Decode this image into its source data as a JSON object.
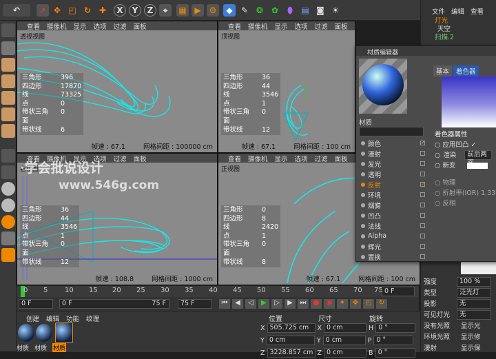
{
  "toolbar": {
    "icons": [
      "undo-icon",
      "select-icon",
      "move-icon",
      "scale-icon",
      "rotate-icon",
      "cursor-add-icon",
      "x-axis-icon",
      "y-axis-icon",
      "z-axis-icon",
      "world-icon",
      "render-view-icon",
      "render-picture-icon",
      "render-settings-icon",
      "cube-icon",
      "pen-icon",
      "sds-icon",
      "array-icon",
      "deformer-icon",
      "scene-icon",
      "camera-icon",
      "light-icon"
    ],
    "axis_x": "X",
    "axis_y": "Y",
    "axis_z": "Z"
  },
  "viewports": {
    "menu": [
      "查看",
      "摄像机",
      "显示",
      "选项",
      "过滤",
      "面板"
    ],
    "persp": {
      "name": "透视视图",
      "stats": [
        [
          "三角形",
          "396"
        ],
        [
          "四边形",
          "17870"
        ],
        [
          "线",
          "73325"
        ],
        [
          "点",
          "0"
        ],
        [
          "带状三角面",
          "0"
        ],
        [
          "带状线",
          "6"
        ]
      ],
      "fps": "帧速 : 67.1",
      "grid": "网格间距 : 100000 cm"
    },
    "top": {
      "name": "顶视图",
      "stats": [
        [
          "三角形",
          "36"
        ],
        [
          "四边形",
          "44"
        ],
        [
          "线",
          "3546"
        ],
        [
          "点",
          "1"
        ],
        [
          "带状三角面",
          "0"
        ],
        [
          "带状线",
          "12"
        ]
      ],
      "fps": "帧速 : 67.1",
      "grid": "网格间距 : 100 cm"
    },
    "right": {
      "name": "右视图",
      "stats": [
        [
          "三角形",
          "36"
        ],
        [
          "四边形",
          "44"
        ],
        [
          "线",
          "3546"
        ],
        [
          "点",
          "1"
        ],
        [
          "带状三角面",
          "0"
        ],
        [
          "带状线",
          "12"
        ]
      ],
      "fps": "帧速 : 108.8",
      "grid": "网格间距 : 1000 cm"
    },
    "front": {
      "name": "正视图",
      "stats": [
        [
          "三角形",
          "0"
        ],
        [
          "四边形",
          "8"
        ],
        [
          "线",
          "2420"
        ],
        [
          "点",
          "1"
        ],
        [
          "带状三角面",
          "0"
        ],
        [
          "带状线",
          "8"
        ]
      ],
      "fps": "帧速 : 67.1",
      "grid": "网格间距 : 100 cm"
    }
  },
  "watermark": {
    "text": "·学会批说设计",
    "url": "www.546g.com"
  },
  "timeline": {
    "ticks": [
      "0",
      "5",
      "10",
      "15",
      "20",
      "25",
      "30",
      "35",
      "40",
      "45",
      "50",
      "55",
      "60",
      "65",
      "70",
      "75"
    ],
    "current": "0 F"
  },
  "transport": {
    "start": "0 F",
    "start2": "0 F",
    "end": "75 F",
    "end2": "75 F"
  },
  "material_bar": {
    "menu": [
      "创建",
      "编辑",
      "功能",
      "纹理"
    ],
    "items": [
      "材质",
      "材质",
      "材质"
    ]
  },
  "coords": {
    "h_pos": "位置",
    "h_size": "尺寸",
    "h_rot": "旋转",
    "rows": [
      [
        "X",
        "505.725 cm",
        "X",
        "0 cm",
        "H",
        "0 °"
      ],
      [
        "Y",
        "0 cm",
        "Y",
        "0 cm",
        "P",
        "0 °"
      ],
      [
        "Z",
        "3228.857 cm",
        "Z",
        "0 cm",
        "B",
        "0 °"
      ]
    ]
  },
  "objects": {
    "menu": [
      "文件",
      "编辑",
      "查看"
    ],
    "items": [
      "灯光",
      "天空",
      "扫描.2"
    ]
  },
  "attributes": {
    "rows": [
      [
        "强度",
        "100 %"
      ],
      [
        "类型",
        "泛光灯"
      ],
      [
        "投影",
        "无"
      ],
      [
        "可见灯光",
        "无"
      ]
    ],
    "checks": [
      [
        "没有光照",
        "显示光"
      ],
      [
        "环境光照",
        "显示修"
      ],
      [
        "漫射",
        "显示保"
      ]
    ]
  },
  "material_editor": {
    "title": "材质编辑器",
    "name": "材质",
    "tabs": [
      "基本",
      "着色器"
    ],
    "channels": [
      [
        "颜色",
        "✓"
      ],
      [
        "漫射",
        ""
      ],
      [
        "发光",
        ""
      ],
      [
        "透明",
        ""
      ],
      [
        "反射",
        "✓"
      ],
      [
        "环境",
        ""
      ],
      [
        "烟雾",
        ""
      ],
      [
        "凹凸",
        ""
      ],
      [
        "法线",
        ""
      ],
      [
        "Alpha",
        ""
      ],
      [
        "辉光",
        ""
      ],
      [
        "置换",
        ""
      ]
    ],
    "section": "着色器属性",
    "apply_bump": "应用凹凸",
    "render_label": "渲染",
    "render_value": "前后两面",
    "fade": "新变",
    "physical": "物理",
    "ior_label": "折射率(IOR)",
    "ior_value": "1.333",
    "reverse": "反相"
  }
}
